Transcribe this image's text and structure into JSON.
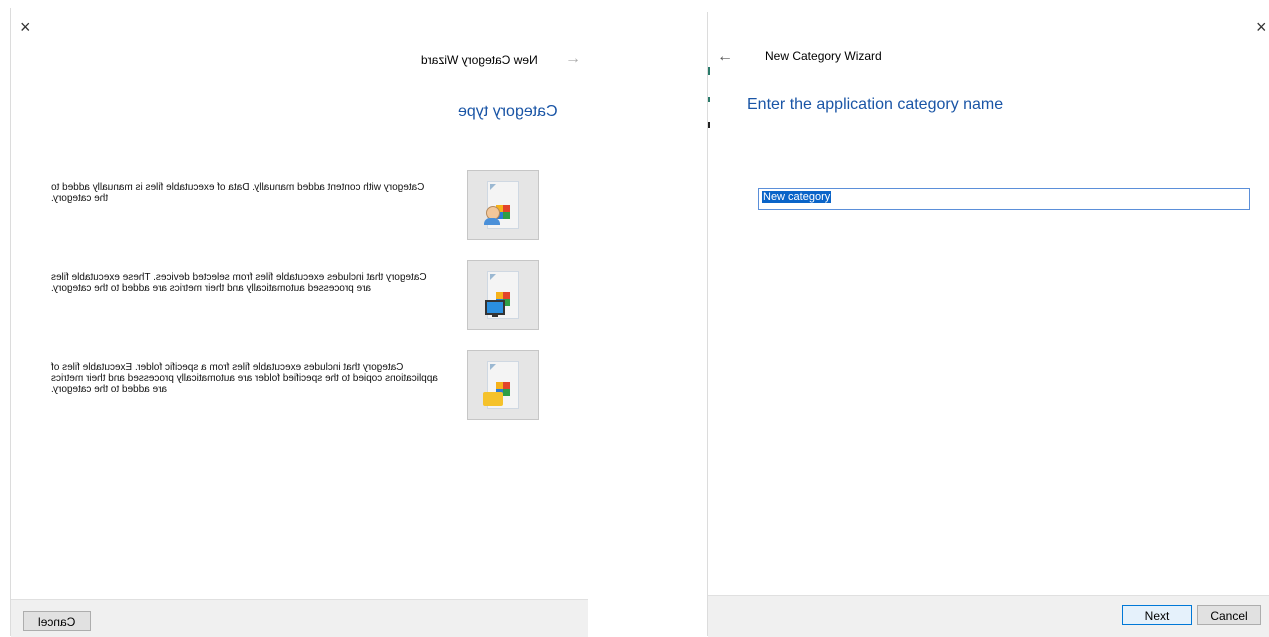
{
  "left": {
    "title": "New Category Wizard",
    "heading": "Category type",
    "options": [
      {
        "line1": "Category with content added manually. Data of executable files is manually added to",
        "line2": "the category.",
        "line3": ""
      },
      {
        "line1": "Category that includes executable files from selected devices. These executable files",
        "line2": "are processed automatically and their metrics are added to the category.",
        "line3": ""
      },
      {
        "line1": "Category that includes executable files from a specific folder. Executable files of",
        "line2": "applications copied to the specified folder are automatically processed and their metrics",
        "line3": "are added to the category."
      }
    ],
    "cancel_label": "Cancel",
    "close_icon": "×",
    "arrow_icon": "→"
  },
  "right": {
    "title": "New Category Wizard",
    "heading": "Enter the application category name",
    "input_value": "New category",
    "next_label": "Next",
    "cancel_label": "Cancel",
    "close_icon": "×",
    "back_icon": "←"
  },
  "colors": {
    "heading": "#1a55a6",
    "footer": "#f0f0f0",
    "selection": "#0a64c8",
    "tile": "#e5e5e5"
  }
}
